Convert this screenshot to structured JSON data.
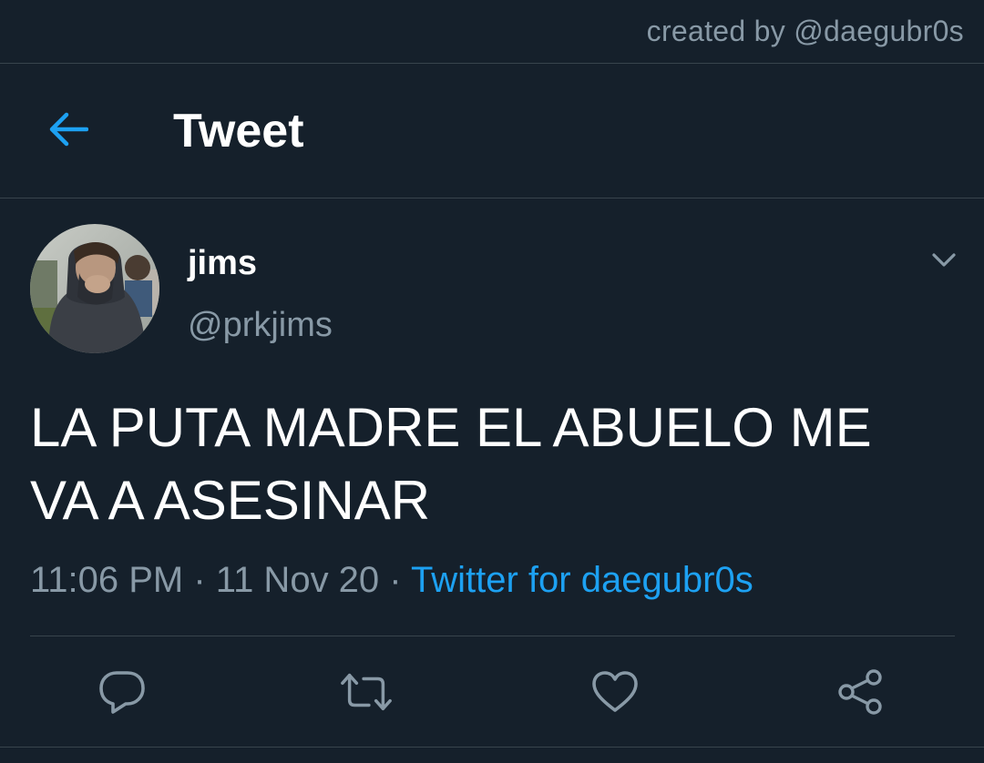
{
  "watermark": "created by @daegubr0s",
  "header": {
    "title": "Tweet",
    "back_icon": "arrow-left-icon"
  },
  "tweet": {
    "author": {
      "display_name": "jims",
      "handle": "@prkjims"
    },
    "text_line1": "LA PUTA MADRE EL ABUELO ME",
    "text_line2": "VA A ASESINAR",
    "time": "11:06 PM",
    "separator": " · ",
    "date": "11 Nov 20",
    "source": "Twitter for daegubr0s"
  },
  "actions": [
    {
      "icon": "reply-icon"
    },
    {
      "icon": "retweet-icon"
    },
    {
      "icon": "like-icon"
    },
    {
      "icon": "share-icon"
    }
  ],
  "colors": {
    "background": "#15202b",
    "accent": "#1da1f2",
    "secondary_text": "#8899a6",
    "divider": "#38444d"
  }
}
